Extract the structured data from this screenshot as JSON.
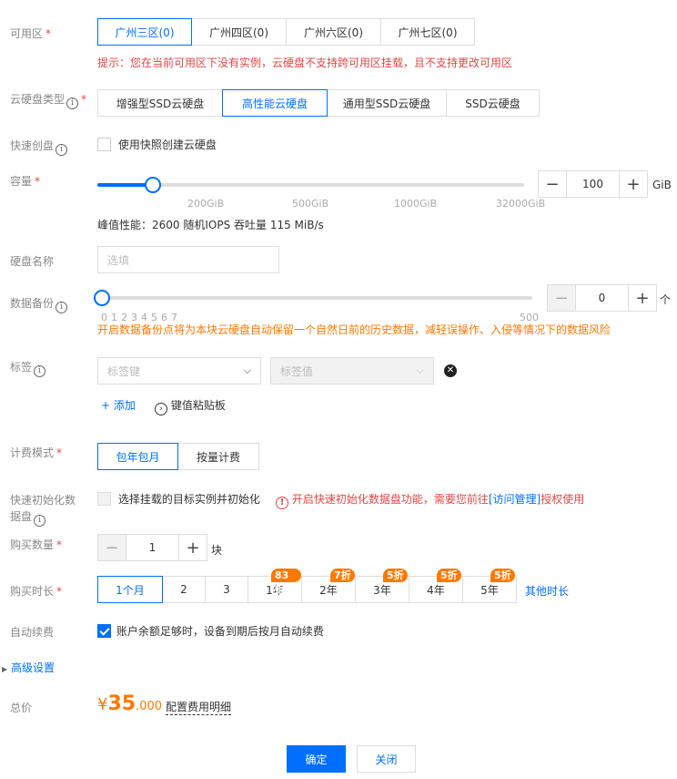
{
  "zone": {
    "label": "可用区",
    "options": [
      "广州三区(0)",
      "广州四区(0)",
      "广州六区(0)",
      "广州七区(0)"
    ],
    "selected": "广州三区(0)",
    "hint": "提示：您在当前可用区下没有实例，云硬盘不支持跨可用区挂载，且不支持更改可用区"
  },
  "disk_type": {
    "label": "云硬盘类型",
    "options": [
      "增强型SSD云硬盘",
      "高性能云硬盘",
      "通用型SSD云硬盘",
      "SSD云硬盘"
    ],
    "selected": "高性能云硬盘"
  },
  "snapshot": {
    "label": "快速创盘",
    "checkbox_label": "使用快照创建云硬盘",
    "checked": false
  },
  "capacity": {
    "label": "容量",
    "ticks": [
      "200GiB",
      "500GiB",
      "1000GiB",
      "32000GiB"
    ],
    "value": "100",
    "unit": "GiB",
    "perf": "峰值性能：2600 随机IOPS 吞吐量 115 MiB/s",
    "slider_fraction": 0.13
  },
  "disk_name": {
    "label": "硬盘名称",
    "placeholder": "选填"
  },
  "backup": {
    "label": "数据备份",
    "ticks": [
      "0",
      "1",
      "2",
      "3",
      "4",
      "5",
      "6",
      "7"
    ],
    "max_tick": "500",
    "value": "0",
    "unit": "个",
    "hint": "开启数据备份点将为本块云硬盘自动保留一个自然日前的历史数据，减轻误操作、入侵等情况下的数据风险"
  },
  "tags": {
    "label": "标签",
    "key_placeholder": "标签键",
    "value_placeholder": "标签值",
    "add_label": "添加",
    "paste_label": "键值粘贴板"
  },
  "billing": {
    "label": "计费模式",
    "options": [
      "包年包月",
      "按量计费"
    ],
    "selected": "包年包月"
  },
  "init": {
    "label_line1": "快速初始化数",
    "label_line2": "据盘",
    "checkbox_label": "选择挂载的目标实例并初始化",
    "warn_text": "开启快速初始化数据盘功能，需要您前往",
    "warn_link": "[访问管理]",
    "warn_tail": "授权使用"
  },
  "quantity": {
    "label": "购买数量",
    "value": "1",
    "unit": "块"
  },
  "duration": {
    "label": "购买时长",
    "options": [
      {
        "label": "1个月",
        "badge": ""
      },
      {
        "label": "2",
        "badge": ""
      },
      {
        "label": "3",
        "badge": ""
      },
      {
        "label": "1年",
        "badge": "83折"
      },
      {
        "label": "2年",
        "badge": "7折"
      },
      {
        "label": "3年",
        "badge": "5折"
      },
      {
        "label": "4年",
        "badge": "5折"
      },
      {
        "label": "5年",
        "badge": "5折"
      }
    ],
    "selected": "1个月",
    "other_label": "其他时长"
  },
  "auto_renew": {
    "label": "自动续费",
    "checkbox_label": "账户余额足够时，设备到期后按月自动续费",
    "checked": true
  },
  "advanced": {
    "label": "高级设置"
  },
  "price": {
    "label": "总价",
    "currency": "¥",
    "integer": "35",
    "decimal": ".000",
    "detail_label": "配置费用明细"
  },
  "footer": {
    "confirm_label": "确定",
    "close_label": "关闭"
  },
  "colors": {
    "primary": "#006eff",
    "warning": "#e54545",
    "accent": "#ff7800"
  }
}
